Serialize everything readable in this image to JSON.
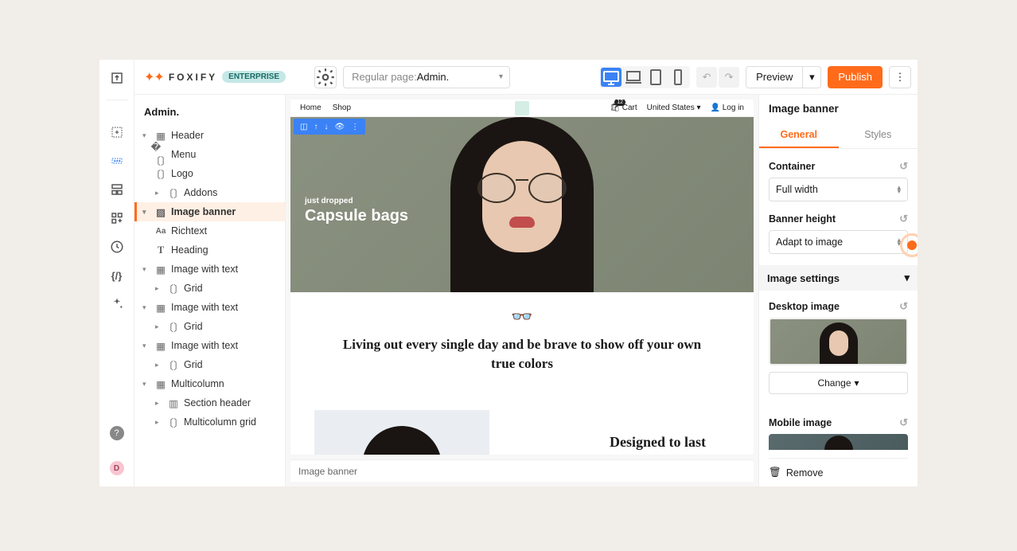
{
  "brand": {
    "name": "FOXIFY",
    "badge": "ENTERPRISE"
  },
  "page_selector": {
    "prefix": "Regular page: ",
    "value": "Admin."
  },
  "topbar": {
    "preview": "Preview",
    "publish": "Publish"
  },
  "outline": {
    "title": "Admin.",
    "header": "Header",
    "menu": "Menu",
    "logo": "Logo",
    "addons": "Addons",
    "image_banner": "Image banner",
    "richtext": "Richtext",
    "heading": "Heading",
    "iwt1": "Image with text",
    "grid1": "Grid",
    "iwt2": "Image with text",
    "grid2": "Grid",
    "iwt3": "Image with text",
    "grid3": "Grid",
    "multicolumn": "Multicolumn",
    "section_header": "Section header",
    "multicolumn_grid": "Multicolumn grid"
  },
  "preview_nav": {
    "home": "Home",
    "shop": "Shop",
    "cart": "Cart",
    "country": "United States",
    "login": "Log in"
  },
  "hero": {
    "eyebrow": "just dropped",
    "title": "Capsule bags"
  },
  "tagline": "Living out every single day and be brave to show off your own true colors",
  "section2": "Designed to last",
  "breadcrumb": "Image banner",
  "inspector": {
    "title": "Image banner",
    "tab_general": "General",
    "tab_styles": "Styles",
    "container_label": "Container",
    "container_value": "Full width",
    "banner_height_label": "Banner height",
    "banner_height_value": "Adapt to image",
    "image_settings": "Image settings",
    "desktop_image": "Desktop image",
    "change": "Change",
    "mobile_image": "Mobile image",
    "remove": "Remove"
  },
  "avatar_initial": "D"
}
